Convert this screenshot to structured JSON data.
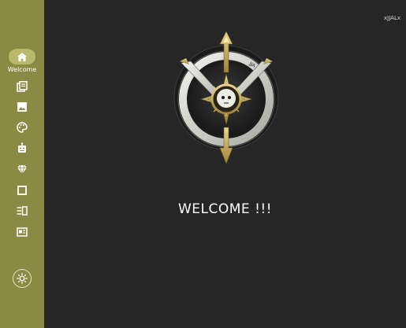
{
  "sidebar": {
    "home": {
      "label": "Welcome",
      "icon": "home-icon"
    },
    "items": [
      {
        "icon": "library-icon"
      },
      {
        "icon": "image-icon"
      },
      {
        "icon": "palette-icon"
      },
      {
        "icon": "robot-icon"
      },
      {
        "icon": "diamond-icon"
      },
      {
        "icon": "square-icon"
      },
      {
        "icon": "list-view-icon"
      },
      {
        "icon": "newspaper-icon"
      }
    ],
    "theme_toggle": {
      "icon": "sun-icon"
    }
  },
  "header": {
    "user_tag": "xJJALx"
  },
  "main": {
    "emblem": {
      "icon": "compass-shield-emblem",
      "inscription": "JJA"
    },
    "welcome_text": "WELCOME !!!"
  },
  "colors": {
    "sidebar_bg": "#8a8a45",
    "sidebar_active": "#b9b96c",
    "main_bg": "#262626",
    "accent_gold": "#c9b45a"
  }
}
